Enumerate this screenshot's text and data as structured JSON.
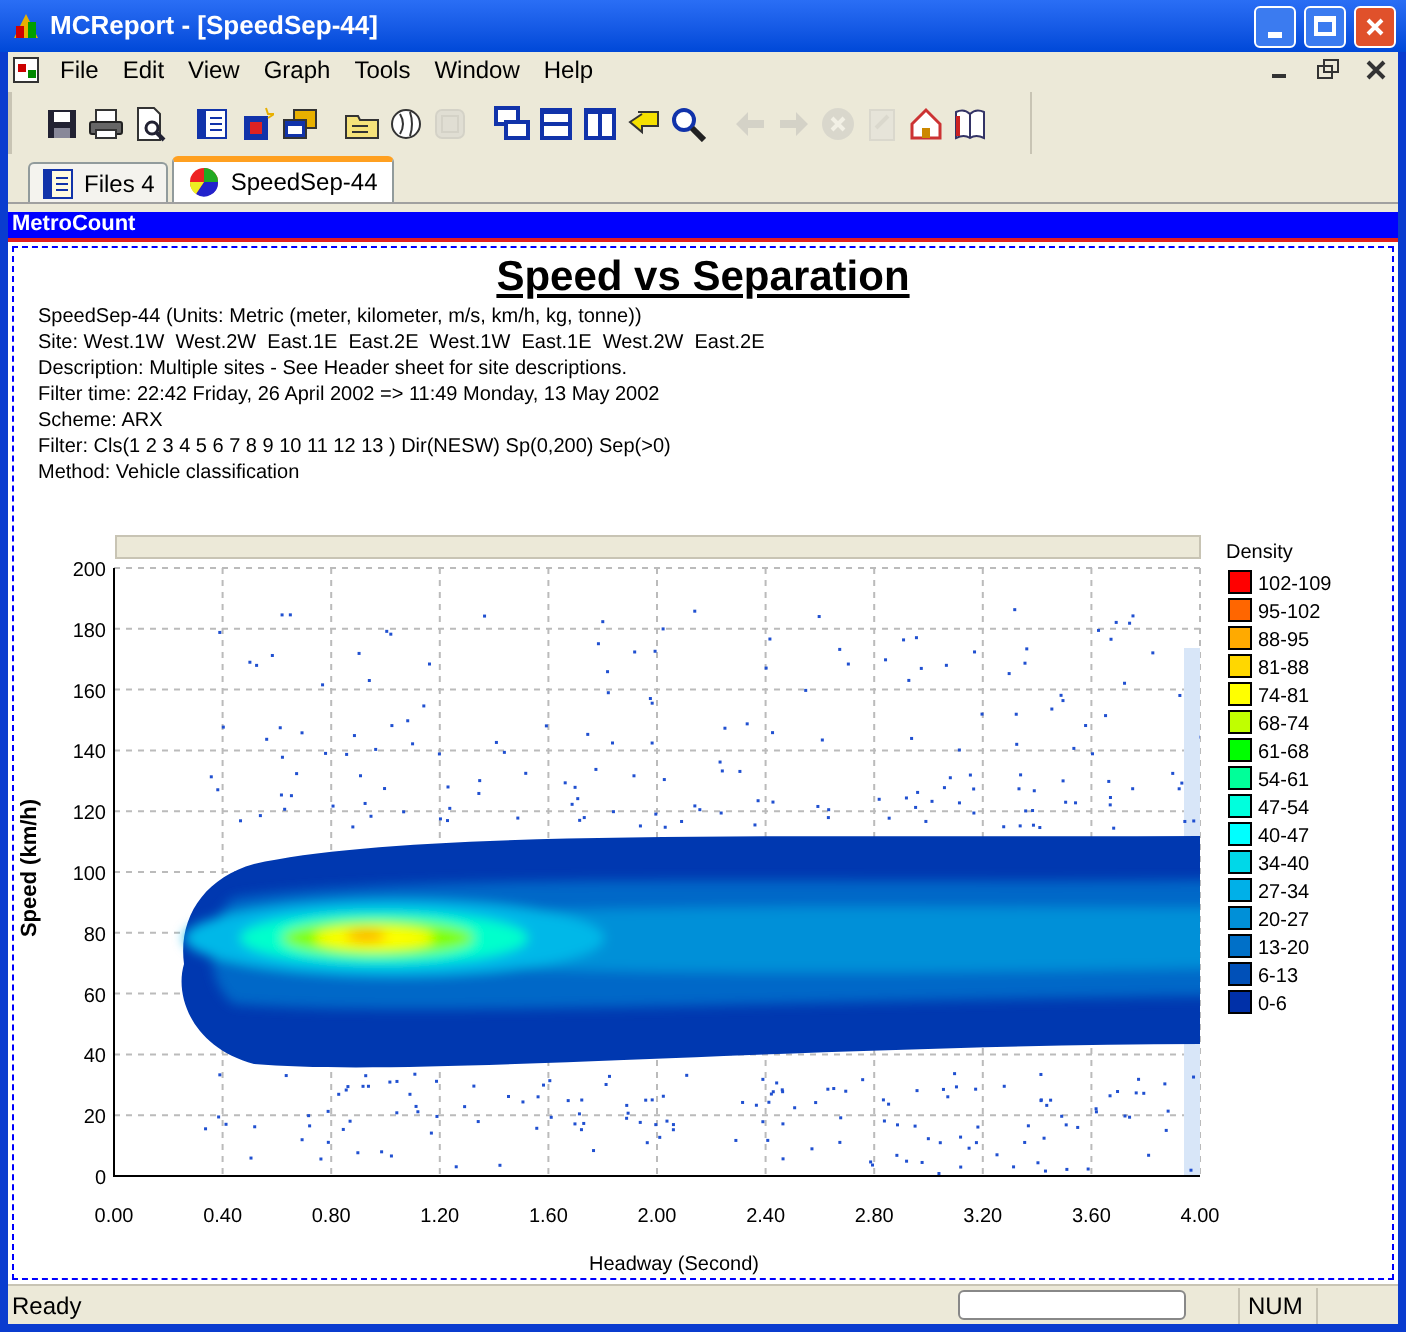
{
  "window": {
    "title": "MCReport - [SpeedSep-44]"
  },
  "menu": [
    "File",
    "Edit",
    "View",
    "Graph",
    "Tools",
    "Window",
    "Help"
  ],
  "toolbar": [
    {
      "kind": "save",
      "disabled": false
    },
    {
      "kind": "print",
      "disabled": false
    },
    {
      "kind": "preview",
      "disabled": false
    },
    {
      "kind": "separator"
    },
    {
      "kind": "list",
      "disabled": false
    },
    {
      "kind": "new",
      "disabled": false
    },
    {
      "kind": "windows",
      "disabled": false
    },
    {
      "kind": "separator"
    },
    {
      "kind": "folder",
      "disabled": false
    },
    {
      "kind": "globe",
      "disabled": false
    },
    {
      "kind": "grid",
      "disabled": true
    },
    {
      "kind": "separator"
    },
    {
      "kind": "cascade",
      "disabled": false
    },
    {
      "kind": "tile-h",
      "disabled": false
    },
    {
      "kind": "tile-v",
      "disabled": false
    },
    {
      "kind": "back",
      "disabled": false
    },
    {
      "kind": "search",
      "disabled": false
    },
    {
      "kind": "separator"
    },
    {
      "kind": "left",
      "disabled": true
    },
    {
      "kind": "right",
      "disabled": true
    },
    {
      "kind": "stop",
      "disabled": true
    },
    {
      "kind": "page",
      "disabled": true
    },
    {
      "kind": "home",
      "disabled": false
    },
    {
      "kind": "book",
      "disabled": false
    }
  ],
  "tabs": [
    {
      "label": "Files 4",
      "selected": false
    },
    {
      "label": "SpeedSep-44",
      "selected": true
    }
  ],
  "panel_title": "MetroCount",
  "report": {
    "title": "Speed vs Separation",
    "lines": [
      "SpeedSep-44 (Units: Metric (meter, kilometer, m/s, km/h, kg, tonne))",
      "Site: West.1W  West.2W  East.1E  East.2E  West.1W  East.1E  West.2W  East.2E",
      "Description: Multiple sites - See Header sheet for site descriptions.",
      "Filter time: 22:42 Friday, 26 April 2002 => 11:49 Monday, 13 May 2002",
      "Scheme: ARX",
      "Filter: Cls(1 2 3 4 5 6 7 8 9 10 11 12 13 ) Dir(NESW) Sp(0,200) Sep(>0)",
      "Method: Vehicle classification"
    ],
    "chart": {
      "xlabel": "Headway (Second)",
      "ylabel": "Speed (km/h)",
      "xticks": [
        "0.00",
        "0.40",
        "0.80",
        "1.20",
        "1.60",
        "2.00",
        "2.40",
        "2.80",
        "3.20",
        "3.60",
        "4.00"
      ],
      "yticks": [
        "200",
        "180",
        "160",
        "140",
        "120",
        "100",
        "80",
        "60",
        "40",
        "20",
        "0"
      ],
      "legend_title": "Density",
      "legend": [
        {
          "label": "102-109",
          "color": "#ff0000"
        },
        {
          "label": "95-102",
          "color": "#ff6600"
        },
        {
          "label": "88-95",
          "color": "#ffaa00"
        },
        {
          "label": "81-88",
          "color": "#ffd700"
        },
        {
          "label": "74-81",
          "color": "#ffff00"
        },
        {
          "label": "68-74",
          "color": "#c0ff00"
        },
        {
          "label": "61-68",
          "color": "#00ff00"
        },
        {
          "label": "54-61",
          "color": "#00ff99"
        },
        {
          "label": "47-54",
          "color": "#00ffdd"
        },
        {
          "label": "40-47",
          "color": "#00ffff"
        },
        {
          "label": "34-40",
          "color": "#00d8e8"
        },
        {
          "label": "27-34",
          "color": "#00b0e8"
        },
        {
          "label": "20-27",
          "color": "#0090d8"
        },
        {
          "label": "13-20",
          "color": "#0070c8"
        },
        {
          "label": "6-13",
          "color": "#0050b8"
        },
        {
          "label": "0-6",
          "color": "#0030a8"
        }
      ]
    }
  },
  "status_bar": {
    "text": "Ready",
    "indicator": "NUM"
  }
}
